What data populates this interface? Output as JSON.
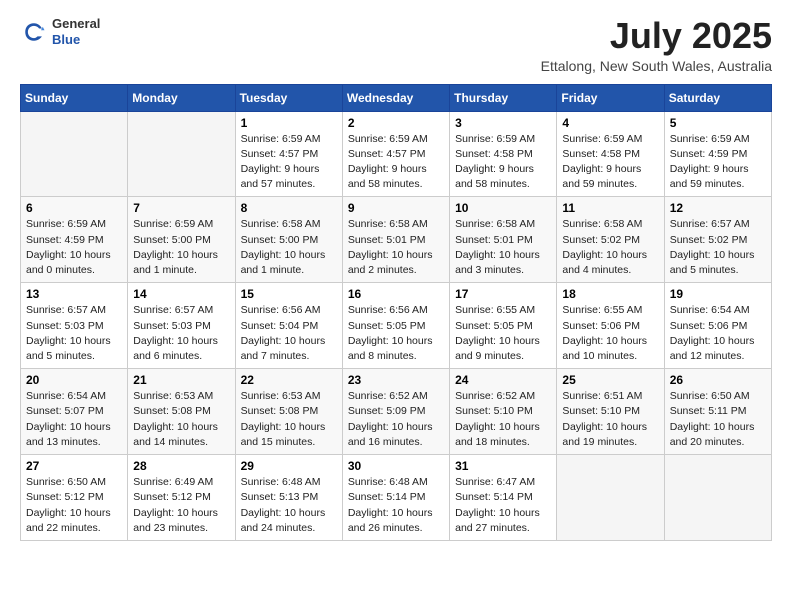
{
  "logo": {
    "general": "General",
    "blue": "Blue"
  },
  "header": {
    "month_year": "July 2025",
    "location": "Ettalong, New South Wales, Australia"
  },
  "days_of_week": [
    "Sunday",
    "Monday",
    "Tuesday",
    "Wednesday",
    "Thursday",
    "Friday",
    "Saturday"
  ],
  "weeks": [
    [
      {
        "day": "",
        "detail": ""
      },
      {
        "day": "",
        "detail": ""
      },
      {
        "day": "1",
        "detail": "Sunrise: 6:59 AM\nSunset: 4:57 PM\nDaylight: 9 hours and 57 minutes."
      },
      {
        "day": "2",
        "detail": "Sunrise: 6:59 AM\nSunset: 4:57 PM\nDaylight: 9 hours and 58 minutes."
      },
      {
        "day": "3",
        "detail": "Sunrise: 6:59 AM\nSunset: 4:58 PM\nDaylight: 9 hours and 58 minutes."
      },
      {
        "day": "4",
        "detail": "Sunrise: 6:59 AM\nSunset: 4:58 PM\nDaylight: 9 hours and 59 minutes."
      },
      {
        "day": "5",
        "detail": "Sunrise: 6:59 AM\nSunset: 4:59 PM\nDaylight: 9 hours and 59 minutes."
      }
    ],
    [
      {
        "day": "6",
        "detail": "Sunrise: 6:59 AM\nSunset: 4:59 PM\nDaylight: 10 hours and 0 minutes."
      },
      {
        "day": "7",
        "detail": "Sunrise: 6:59 AM\nSunset: 5:00 PM\nDaylight: 10 hours and 1 minute."
      },
      {
        "day": "8",
        "detail": "Sunrise: 6:58 AM\nSunset: 5:00 PM\nDaylight: 10 hours and 1 minute."
      },
      {
        "day": "9",
        "detail": "Sunrise: 6:58 AM\nSunset: 5:01 PM\nDaylight: 10 hours and 2 minutes."
      },
      {
        "day": "10",
        "detail": "Sunrise: 6:58 AM\nSunset: 5:01 PM\nDaylight: 10 hours and 3 minutes."
      },
      {
        "day": "11",
        "detail": "Sunrise: 6:58 AM\nSunset: 5:02 PM\nDaylight: 10 hours and 4 minutes."
      },
      {
        "day": "12",
        "detail": "Sunrise: 6:57 AM\nSunset: 5:02 PM\nDaylight: 10 hours and 5 minutes."
      }
    ],
    [
      {
        "day": "13",
        "detail": "Sunrise: 6:57 AM\nSunset: 5:03 PM\nDaylight: 10 hours and 5 minutes."
      },
      {
        "day": "14",
        "detail": "Sunrise: 6:57 AM\nSunset: 5:03 PM\nDaylight: 10 hours and 6 minutes."
      },
      {
        "day": "15",
        "detail": "Sunrise: 6:56 AM\nSunset: 5:04 PM\nDaylight: 10 hours and 7 minutes."
      },
      {
        "day": "16",
        "detail": "Sunrise: 6:56 AM\nSunset: 5:05 PM\nDaylight: 10 hours and 8 minutes."
      },
      {
        "day": "17",
        "detail": "Sunrise: 6:55 AM\nSunset: 5:05 PM\nDaylight: 10 hours and 9 minutes."
      },
      {
        "day": "18",
        "detail": "Sunrise: 6:55 AM\nSunset: 5:06 PM\nDaylight: 10 hours and 10 minutes."
      },
      {
        "day": "19",
        "detail": "Sunrise: 6:54 AM\nSunset: 5:06 PM\nDaylight: 10 hours and 12 minutes."
      }
    ],
    [
      {
        "day": "20",
        "detail": "Sunrise: 6:54 AM\nSunset: 5:07 PM\nDaylight: 10 hours and 13 minutes."
      },
      {
        "day": "21",
        "detail": "Sunrise: 6:53 AM\nSunset: 5:08 PM\nDaylight: 10 hours and 14 minutes."
      },
      {
        "day": "22",
        "detail": "Sunrise: 6:53 AM\nSunset: 5:08 PM\nDaylight: 10 hours and 15 minutes."
      },
      {
        "day": "23",
        "detail": "Sunrise: 6:52 AM\nSunset: 5:09 PM\nDaylight: 10 hours and 16 minutes."
      },
      {
        "day": "24",
        "detail": "Sunrise: 6:52 AM\nSunset: 5:10 PM\nDaylight: 10 hours and 18 minutes."
      },
      {
        "day": "25",
        "detail": "Sunrise: 6:51 AM\nSunset: 5:10 PM\nDaylight: 10 hours and 19 minutes."
      },
      {
        "day": "26",
        "detail": "Sunrise: 6:50 AM\nSunset: 5:11 PM\nDaylight: 10 hours and 20 minutes."
      }
    ],
    [
      {
        "day": "27",
        "detail": "Sunrise: 6:50 AM\nSunset: 5:12 PM\nDaylight: 10 hours and 22 minutes."
      },
      {
        "day": "28",
        "detail": "Sunrise: 6:49 AM\nSunset: 5:12 PM\nDaylight: 10 hours and 23 minutes."
      },
      {
        "day": "29",
        "detail": "Sunrise: 6:48 AM\nSunset: 5:13 PM\nDaylight: 10 hours and 24 minutes."
      },
      {
        "day": "30",
        "detail": "Sunrise: 6:48 AM\nSunset: 5:14 PM\nDaylight: 10 hours and 26 minutes."
      },
      {
        "day": "31",
        "detail": "Sunrise: 6:47 AM\nSunset: 5:14 PM\nDaylight: 10 hours and 27 minutes."
      },
      {
        "day": "",
        "detail": ""
      },
      {
        "day": "",
        "detail": ""
      }
    ]
  ]
}
